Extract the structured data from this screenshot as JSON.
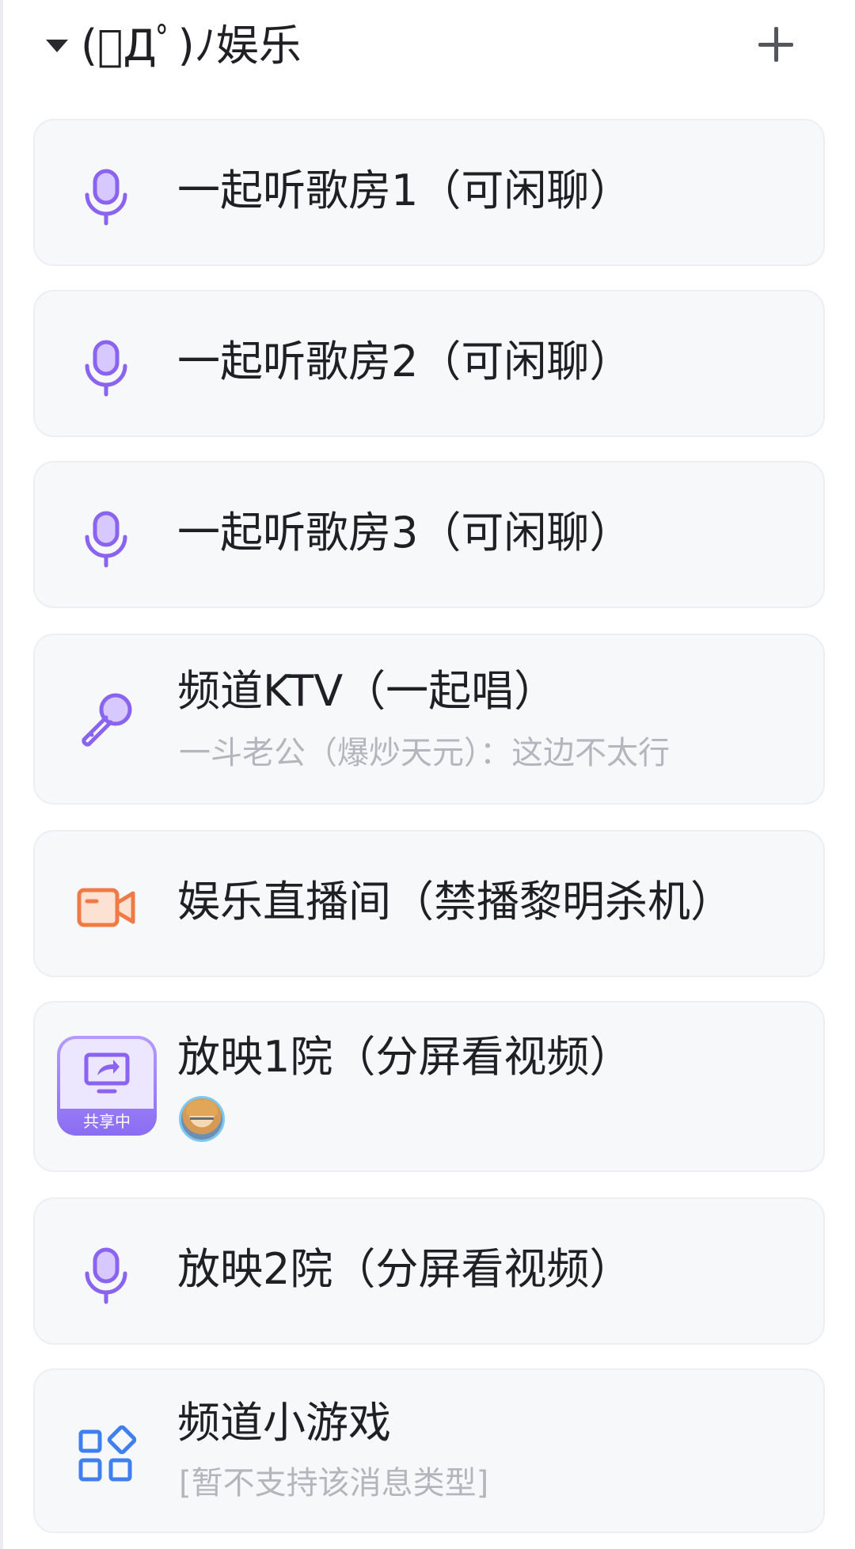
{
  "header": {
    "group_title": "(ﾟДﾟ)ﾉ娱乐"
  },
  "channels": [
    {
      "title": "一起听歌房1（可闲聊）",
      "icon": "microphone-icon"
    },
    {
      "title": "一起听歌房2（可闲聊）",
      "icon": "microphone-icon"
    },
    {
      "title": "一起听歌房3（可闲聊）",
      "icon": "microphone-icon"
    },
    {
      "title": "频道KTV（一起唱）",
      "subtitle": "一斗老公（爆炒天元）：这边不太行",
      "icon": "karaoke-microphone-icon"
    },
    {
      "title": "娱乐直播间（禁播黎明杀机）",
      "icon": "video-camera-icon"
    },
    {
      "title": "放映1院（分屏看视频）",
      "icon": "screen-share-icon",
      "badge": "共享中"
    },
    {
      "title": "放映2院（分屏看视频）",
      "icon": "microphone-icon"
    },
    {
      "title": "频道小游戏",
      "subtitle": "[暂不支持该消息类型]",
      "icon": "mini-apps-icon"
    }
  ],
  "colors": {
    "voice_icon": "#8a63f0",
    "live_icon": "#f07a45",
    "game_icon": "#3f7ff0",
    "card_bg": "#f7f8fa",
    "subtitle": "#b4b6bd"
  }
}
